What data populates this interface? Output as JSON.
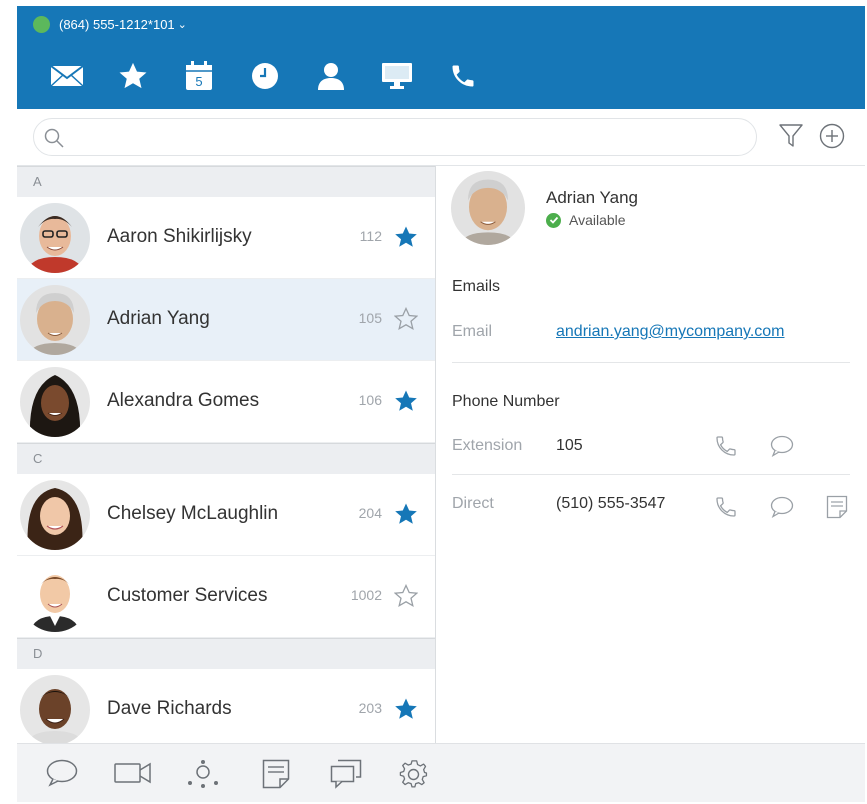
{
  "header": {
    "line_label": "(864) 555-1212*101",
    "status_color": "#5cb85c",
    "accent": "#1677b7"
  },
  "nav_tabs": [
    "envelope-icon",
    "star-icon",
    "calendar-icon",
    "clock-icon",
    "person-icon",
    "monitor-icon",
    "phone-icon"
  ],
  "calendar_day": "5",
  "search": {
    "placeholder": "",
    "value": ""
  },
  "contacts": {
    "sections": [
      {
        "letter": "A",
        "items": [
          {
            "name": "Aaron Shikirlijsky",
            "ext": "112",
            "favorite": true
          },
          {
            "name": "Adrian Yang",
            "ext": "105",
            "favorite": false,
            "selected": true
          },
          {
            "name": "Alexandra Gomes",
            "ext": "106",
            "favorite": true
          }
        ]
      },
      {
        "letter": "C",
        "items": [
          {
            "name": "Chelsey McLaughlin",
            "ext": "204",
            "favorite": true
          },
          {
            "name": "Customer Services",
            "ext": "1002",
            "favorite": false
          }
        ]
      },
      {
        "letter": "D",
        "items": [
          {
            "name": "Dave Richards",
            "ext": "203",
            "favorite": true
          }
        ]
      }
    ]
  },
  "detail": {
    "name": "Adrian Yang",
    "status": "Available",
    "emails_title": "Emails",
    "email_label": "Email",
    "email_value": "andrian.yang@mycompany.com",
    "phone_title": "Phone Number",
    "extension_label": "Extension",
    "extension_value": "105",
    "direct_label": "Direct",
    "direct_value": "(510) 555-3547"
  },
  "bottom_bar": [
    "chat-icon",
    "video-icon",
    "conference-icon",
    "notes-icon",
    "messages-icon",
    "settings-icon"
  ]
}
